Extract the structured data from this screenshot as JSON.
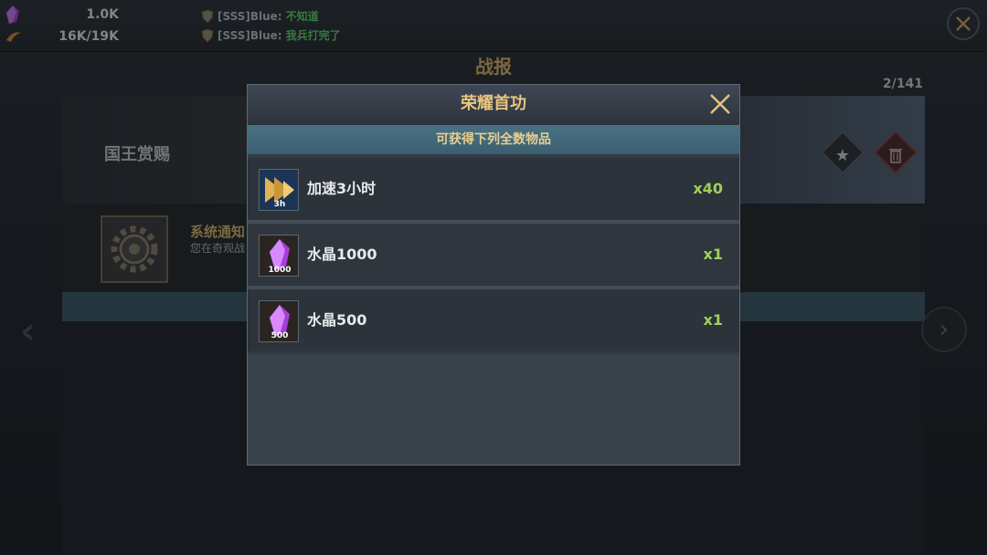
{
  "topbar": {
    "resources": [
      {
        "icon": "crystal-icon",
        "value": "1.0K"
      },
      {
        "icon": "troops-icon",
        "value": "16K/19K"
      }
    ],
    "chat": [
      {
        "name": "[SSS]Blue:",
        "message": "不知道"
      },
      {
        "name": "[SSS]Blue:",
        "message": "我兵打完了"
      }
    ]
  },
  "background": {
    "title": "战报",
    "page_count": "2/141",
    "banner_title": "国王赏赐",
    "message": {
      "title": "系统通知",
      "subtitle": "您在奇观战"
    }
  },
  "dialog": {
    "title": "荣耀首功",
    "subtitle": "可获得下列全数物品",
    "items": [
      {
        "icon": "speedup-icon",
        "icon_label": "3h",
        "name": "加速3小时",
        "count": "x40"
      },
      {
        "icon": "crystal-icon",
        "icon_label": "1000",
        "name": "水晶1000",
        "count": "x1"
      },
      {
        "icon": "crystal-icon",
        "icon_label": "500",
        "name": "水晶500",
        "count": "x1"
      }
    ]
  },
  "colors": {
    "accent_gold": "#e8c57e",
    "count_green": "#9fd15b",
    "chat_green": "#5ed36b"
  }
}
